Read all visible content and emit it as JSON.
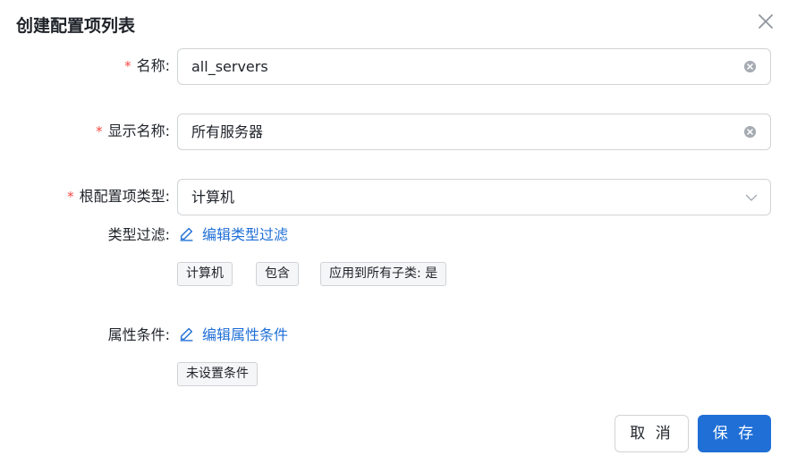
{
  "dialog": {
    "title": "创建配置项列表",
    "close_icon": "close-icon"
  },
  "form": {
    "name": {
      "required_mark": "*",
      "label": "名称:",
      "value": "all_servers",
      "clear_icon": "clear-circle-icon"
    },
    "display_name": {
      "required_mark": "*",
      "label": "显示名称:",
      "value": "所有服务器",
      "clear_icon": "clear-circle-icon"
    },
    "root_ci_type": {
      "required_mark": "*",
      "label": "根配置项类型:",
      "value": "计算机",
      "dropdown_icon": "chevron-down-icon"
    },
    "type_filter": {
      "label": "类型过滤:",
      "edit_link": "编辑类型过滤",
      "edit_icon": "pencil-icon",
      "tags": [
        "计算机",
        "包含",
        "应用到所有子类: 是"
      ]
    },
    "attribute_conditions": {
      "label": "属性条件:",
      "edit_link": "编辑属性条件",
      "edit_icon": "pencil-icon",
      "tags": [
        "未设置条件"
      ]
    }
  },
  "footer": {
    "cancel_label": "取 消",
    "save_label": "保 存"
  },
  "colors": {
    "accent": "#1f6fd6",
    "required": "#f54a45",
    "border": "#d0d3d6",
    "tag_bg": "#f5f6f7"
  }
}
